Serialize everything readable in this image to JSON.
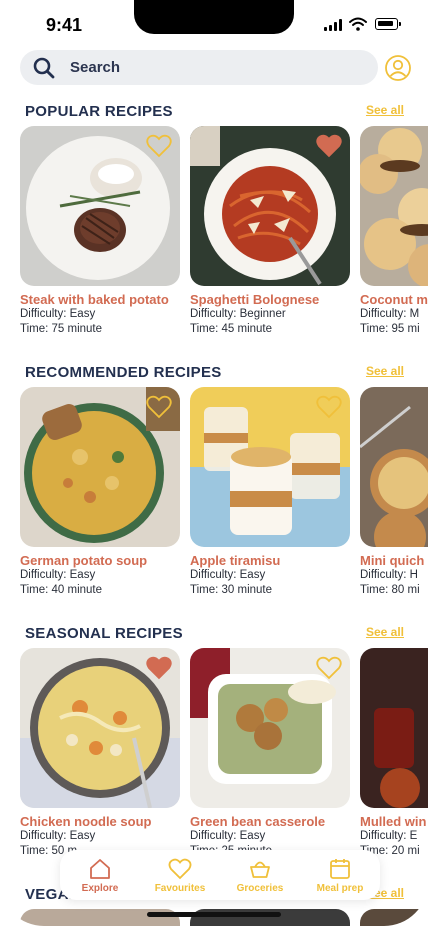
{
  "status": {
    "time": "9:41"
  },
  "search": {
    "placeholder": "Search"
  },
  "colors": {
    "accent": "#d26b52",
    "link": "#f0c03a",
    "heading": "#23304f",
    "searchBg": "#eceef1"
  },
  "sections": [
    {
      "title": "POPULAR RECIPES",
      "see_all": "See all",
      "cards": [
        {
          "name": "Steak with baked potato",
          "difficulty": "Difficulty: Easy",
          "time": "Time: 75 minute",
          "favourite": false
        },
        {
          "name": "Spaghetti Bolognese",
          "difficulty": "Difficulty: Beginner",
          "time": "Time: 45 minute",
          "favourite": true
        },
        {
          "name": "Coconut m",
          "difficulty": "Difficulty: M",
          "time": "Time: 95 mi",
          "favourite": false
        }
      ]
    },
    {
      "title": "RECOMMENDED RECIPES",
      "see_all": "See all",
      "cards": [
        {
          "name": "German potato soup",
          "difficulty": "Difficulty: Easy",
          "time": "Time: 40 minute",
          "favourite": false
        },
        {
          "name": "Apple tiramisu",
          "difficulty": "Difficulty: Easy",
          "time": "Time: 30 minute",
          "favourite": false
        },
        {
          "name": "Mini quich",
          "difficulty": "Difficulty: H",
          "time": "Time: 80 mi",
          "favourite": false
        }
      ]
    },
    {
      "title": "SEASONAL RECIPES",
      "see_all": "See all",
      "cards": [
        {
          "name": "Chicken noodle soup",
          "difficulty": "Difficulty: Easy",
          "time": "Time: 50 m",
          "favourite": true
        },
        {
          "name": "Green bean casserole",
          "difficulty": "Difficulty: Easy",
          "time": "Time: 25 minute",
          "favourite": false
        },
        {
          "name": "Mulled win",
          "difficulty": "Difficulty: E",
          "time": "Time: 20 mi",
          "favourite": false
        }
      ]
    },
    {
      "title": "VEGAN RECIPES",
      "see_all": "See all",
      "cards": []
    }
  ],
  "nav": {
    "items": [
      {
        "label": "Explore",
        "icon": "home-icon",
        "active": true
      },
      {
        "label": "Favourites",
        "icon": "heart-icon",
        "active": false
      },
      {
        "label": "Groceries",
        "icon": "basket-icon",
        "active": false
      },
      {
        "label": "Meal prep",
        "icon": "calendar-icon",
        "active": false
      }
    ]
  }
}
